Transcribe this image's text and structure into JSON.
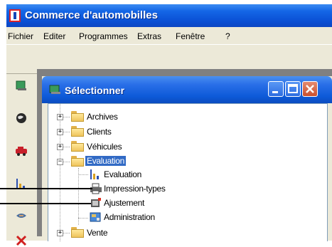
{
  "app": {
    "title": "Commerce d'automobilles"
  },
  "menu": [
    "Fichier",
    "Editer",
    "Programmes",
    "Extras",
    "Fenêtre",
    "?"
  ],
  "side_icons": [
    "book-icon",
    "globe-icon",
    "car-icon",
    "chart-icon",
    "handshake-icon",
    "close-x-icon"
  ],
  "child_window": {
    "title": "Sélectionner"
  },
  "tree": {
    "folders": [
      {
        "label": "Archives",
        "expander": "+"
      },
      {
        "label": "Clients",
        "expander": "+"
      },
      {
        "label": "Véhicules",
        "expander": "+"
      },
      {
        "label": "Evaluation",
        "expander": "−",
        "selected": true
      },
      {
        "label": "Vente",
        "expander": "+"
      }
    ],
    "children": [
      {
        "label": "Evaluation",
        "icon": "evaluation-chart-icon"
      },
      {
        "label": "Impression-types",
        "icon": "printer-icon"
      },
      {
        "label": "Ajustement",
        "icon": "adjust-icon"
      },
      {
        "label": "Administration",
        "icon": "administration-icon"
      }
    ]
  },
  "colors": {
    "titlebar": "#0a4fd4",
    "selection": "#316ac5",
    "folder": "#efc45c"
  }
}
